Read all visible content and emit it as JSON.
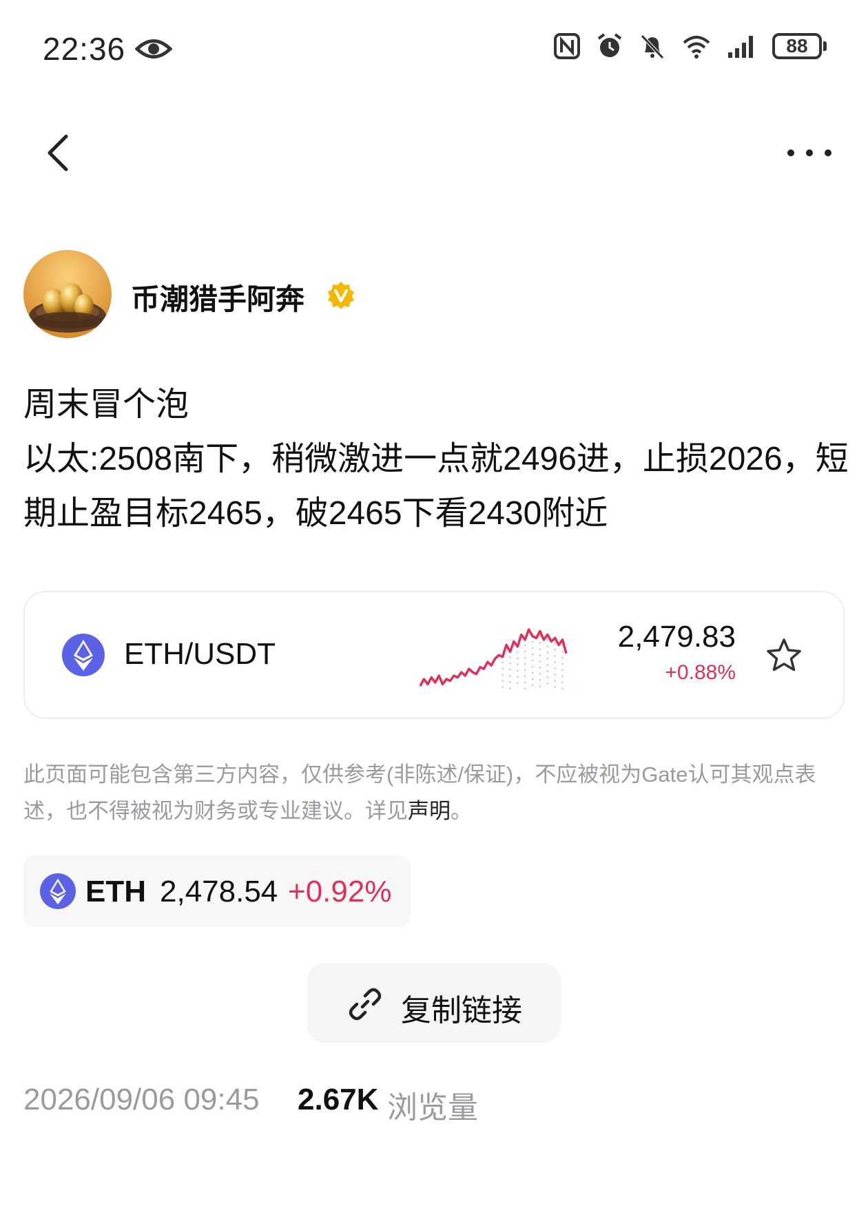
{
  "status_bar": {
    "time": "22:36",
    "battery": "88"
  },
  "author": {
    "name": "币潮猎手阿奔",
    "verified": true
  },
  "post": {
    "text": "周末冒个泡\n以太:2508南下，稍微激进一点就2496进，止损2026，短期止盈目标2465，破2465下看2430附近"
  },
  "market_card": {
    "pair": "ETH/USDT",
    "price": "2,479.83",
    "change": "+0.88%",
    "sparkline_values": [
      2462,
      2466,
      2463,
      2467,
      2464,
      2468,
      2463,
      2466,
      2465,
      2468,
      2467,
      2470,
      2468,
      2472,
      2470,
      2469,
      2473,
      2472,
      2476,
      2474,
      2478,
      2480,
      2479,
      2486,
      2482,
      2488,
      2485,
      2492,
      2489,
      2495,
      2491,
      2490,
      2494,
      2489,
      2492,
      2488,
      2490,
      2486,
      2489,
      2481
    ],
    "up_color": "#e0305a"
  },
  "disclaimer": {
    "text": "此页面可能包含第三方内容，仅供参考(非陈述/保证)，不应被视为Gate认可其观点表述，也不得被视为财务或专业建议。详见",
    "link": "声明",
    "suffix": "。"
  },
  "coin_chip": {
    "symbol": "ETH",
    "price": "2,478.54",
    "change": "+0.92%"
  },
  "copy_link": {
    "label": "复制链接"
  },
  "footer": {
    "date": "2026/09/06 09:45",
    "views": "2.67K",
    "views_label": "浏览量"
  },
  "icons": [
    "eye-icon",
    "nfc-icon",
    "alarm-icon",
    "bell-off-icon",
    "wifi-icon",
    "signal-icon",
    "back-icon",
    "more-icon",
    "verified-icon",
    "eth-logo",
    "star-icon",
    "link-icon"
  ]
}
